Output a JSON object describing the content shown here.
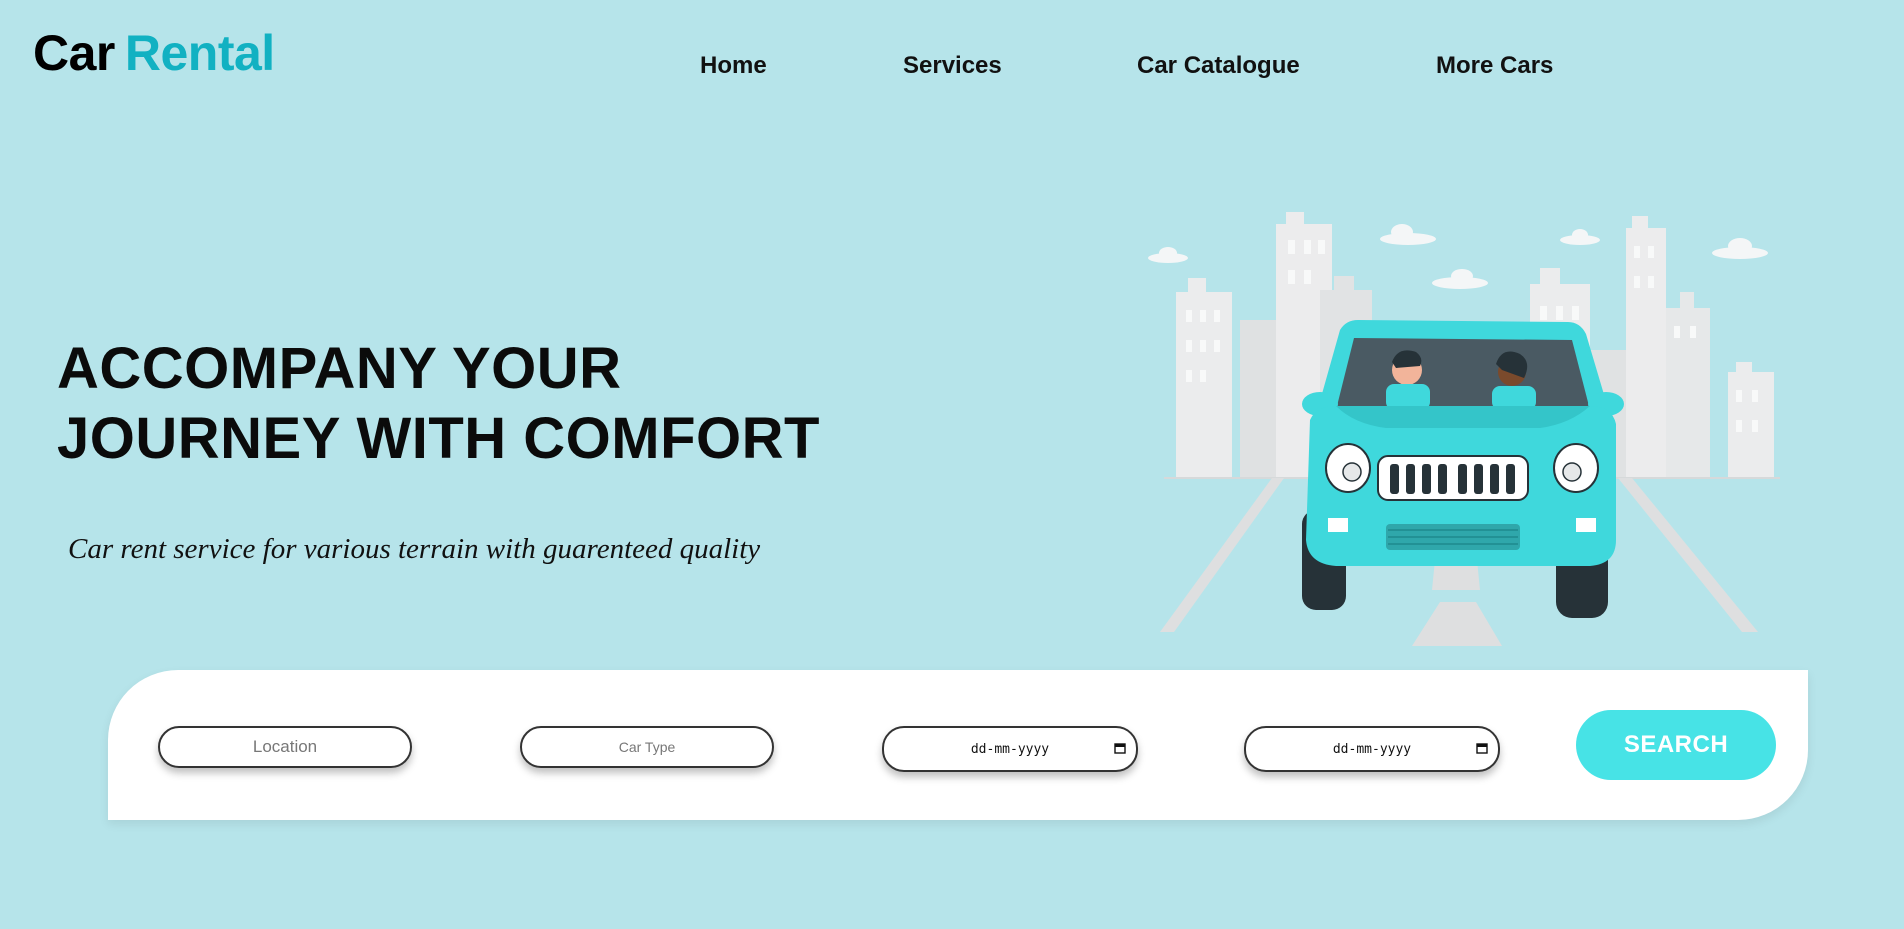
{
  "brand": {
    "word1": "Car",
    "word2": "Rental",
    "accent_color": "#11b1c2"
  },
  "nav": {
    "items": [
      {
        "label": "Home"
      },
      {
        "label": "Services"
      },
      {
        "label": "Car Catalogue"
      },
      {
        "label": "More Cars"
      }
    ]
  },
  "hero": {
    "title_line1": "ACCOMPANY YOUR",
    "title_line2": "JOURNEY WITH COMFORT",
    "subtitle": "Car rent service for various terrain with guarenteed quality",
    "illustration_icon": "car-city-illustration"
  },
  "search": {
    "location_placeholder": "Location",
    "car_type_placeholder": "Car Type",
    "pickup_date_placeholder": "dd-mm-yyyy",
    "return_date_placeholder": "dd-mm-yyyy",
    "button_label": "SEARCH",
    "button_color": "#47e3e6"
  },
  "colors": {
    "background": "#b6e4ea",
    "car_body": "#3fd8dc"
  }
}
